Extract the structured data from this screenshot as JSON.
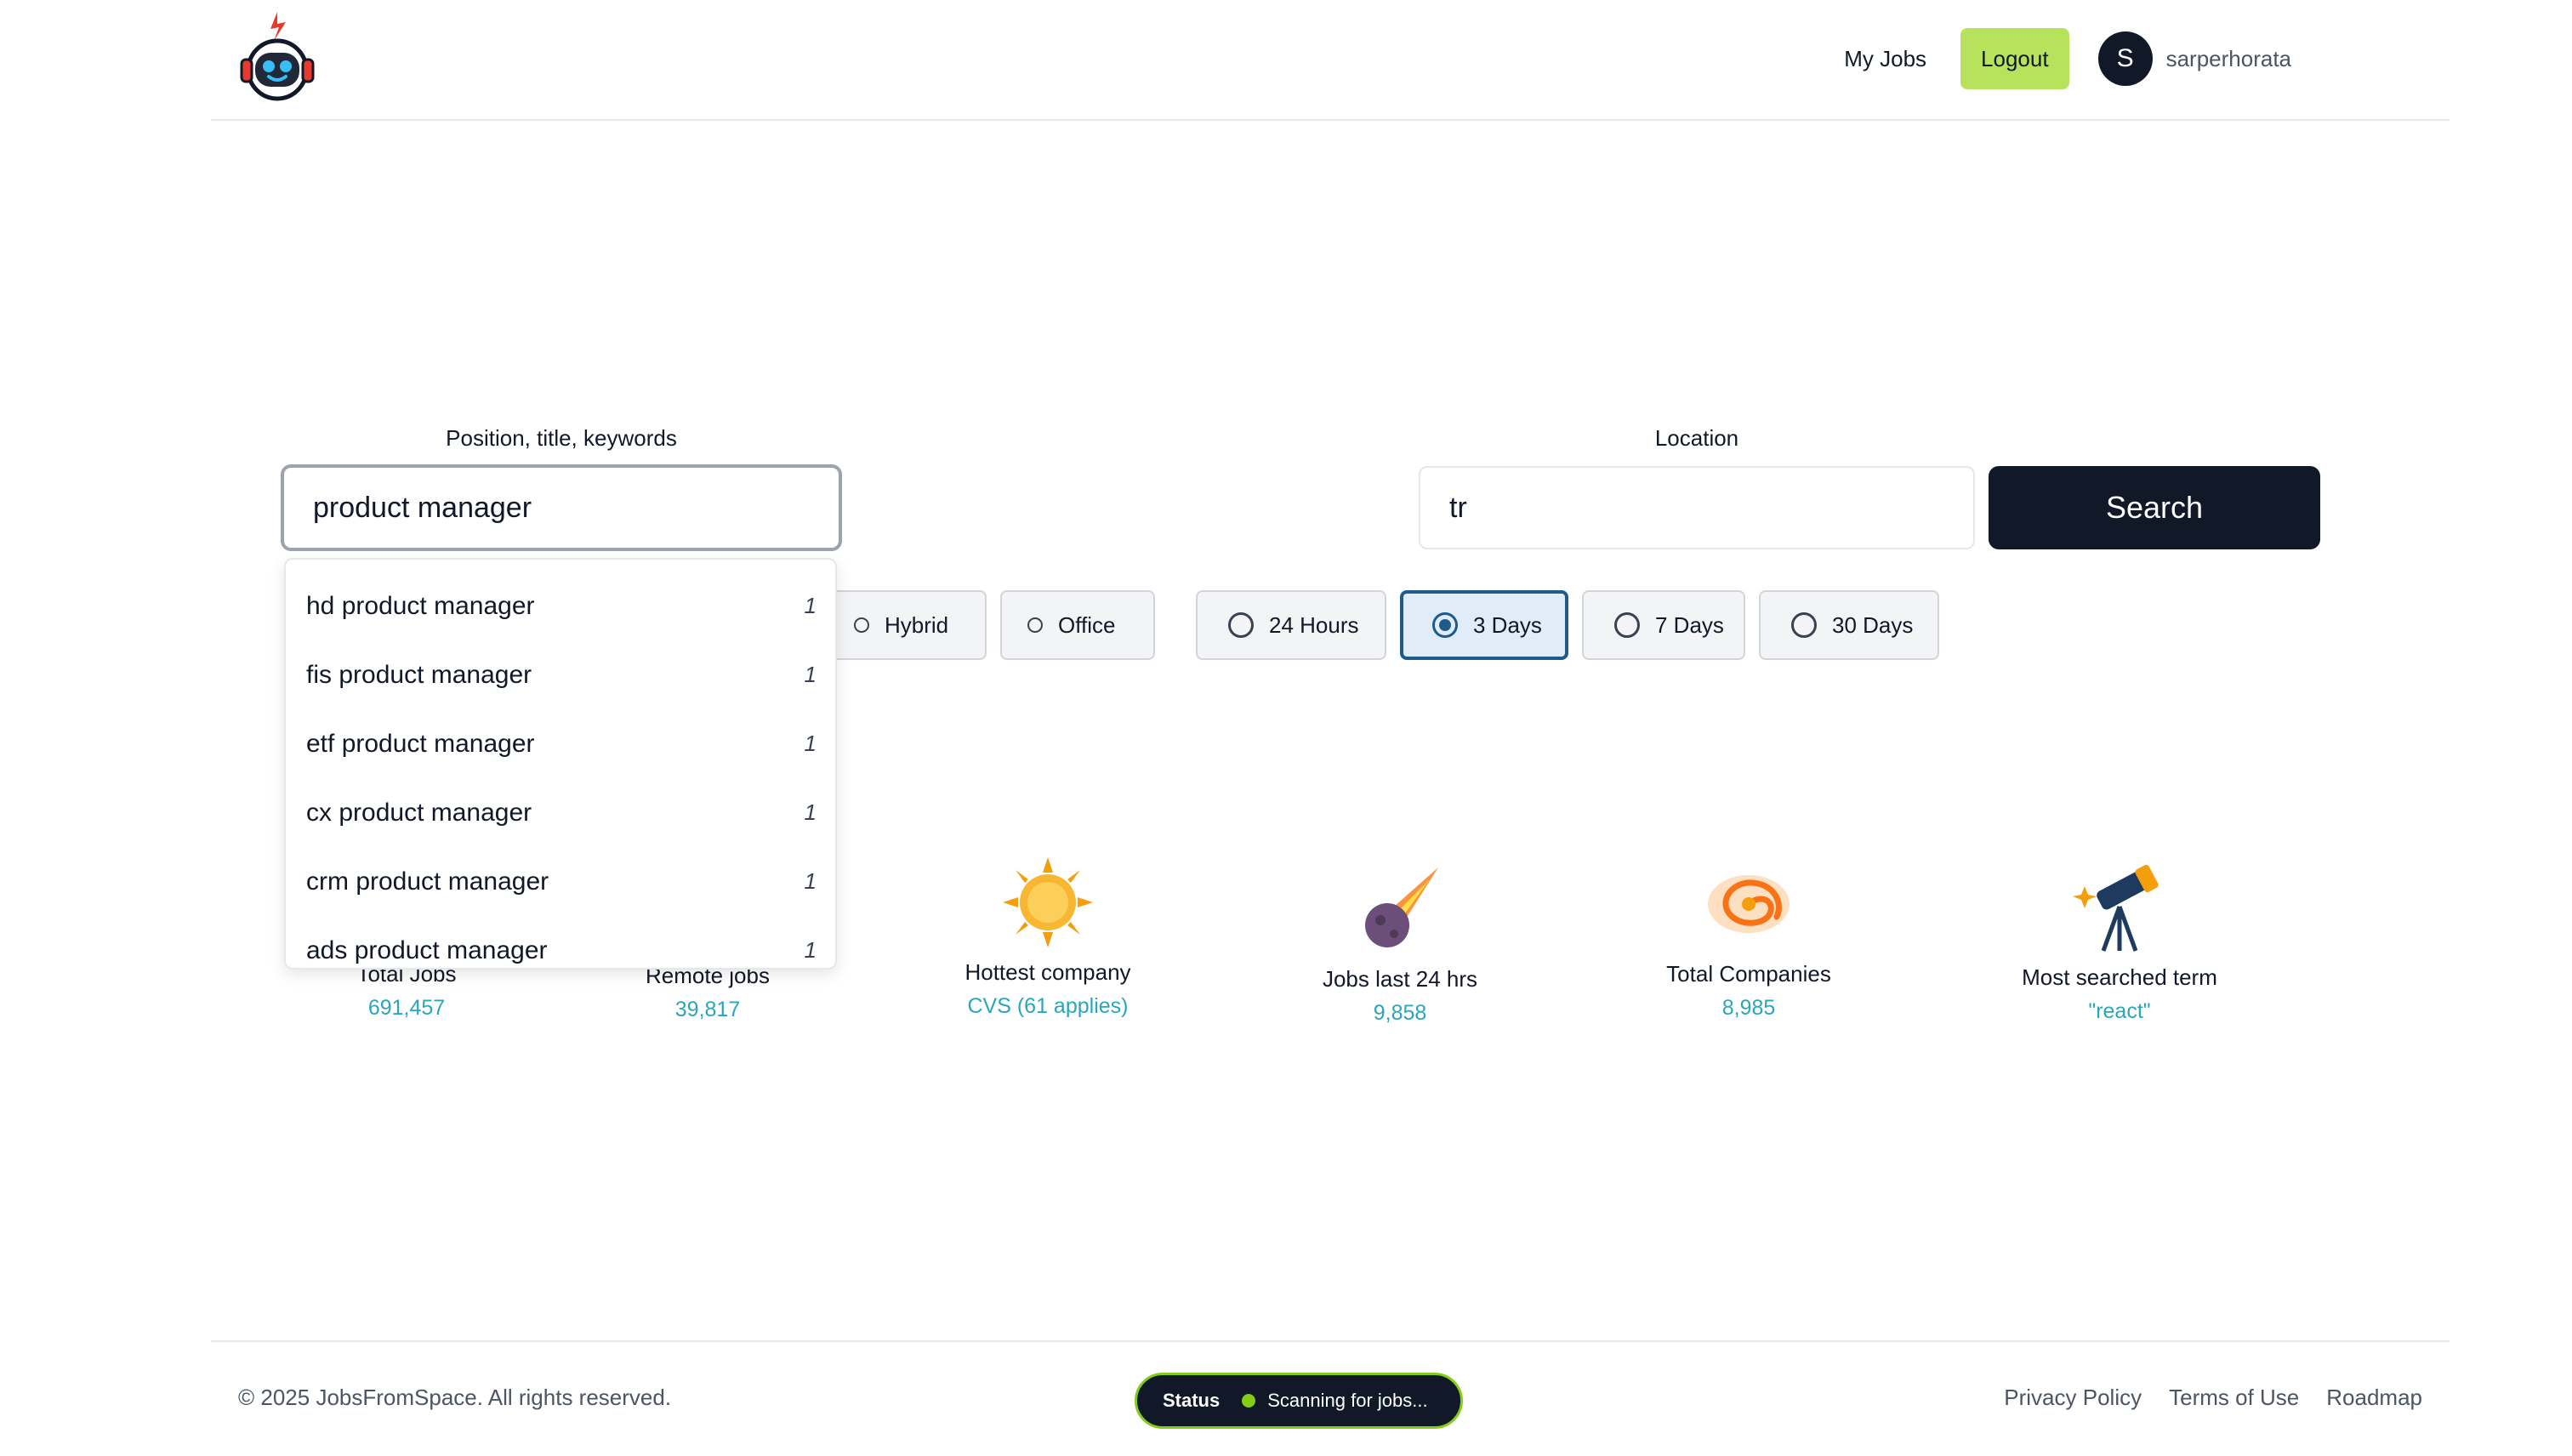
{
  "header": {
    "logo_icon": "robot-astronaut-logo",
    "nav": {
      "my_jobs": "My Jobs",
      "logout": "Logout"
    },
    "user": {
      "avatar_initial": "S",
      "username": "sarperhorata"
    }
  },
  "search": {
    "keywords_label": "Position, title, keywords",
    "keywords_value": "product manager",
    "location_label": "Location",
    "location_value": "tr",
    "search_button": "Search"
  },
  "filters": {
    "work_type": [
      {
        "label": "Hybrid",
        "selected": false
      },
      {
        "label": "Office",
        "selected": false
      }
    ],
    "date_posted": [
      {
        "label": "24 Hours",
        "selected": false
      },
      {
        "label": "3 Days",
        "selected": true
      },
      {
        "label": "7 Days",
        "selected": false
      },
      {
        "label": "30 Days",
        "selected": false
      }
    ]
  },
  "suggestions": [
    {
      "text": "hd product manager",
      "count": "1"
    },
    {
      "text": "fis product manager",
      "count": "1"
    },
    {
      "text": "etf product manager",
      "count": "1"
    },
    {
      "text": "cx product manager",
      "count": "1"
    },
    {
      "text": "crm product manager",
      "count": "1"
    },
    {
      "text": "ads product manager",
      "count": "1"
    }
  ],
  "stats": [
    {
      "title": "Total Jobs",
      "value": "691,457",
      "icon": "rocket-icon"
    },
    {
      "title": "Remote jobs",
      "value": "39,817",
      "icon": "planet-icon"
    },
    {
      "title": "Hottest company",
      "value": "CVS (61 applies)",
      "icon": "sun-icon"
    },
    {
      "title": "Jobs last 24 hrs",
      "value": "9,858",
      "icon": "meteor-icon"
    },
    {
      "title": "Total Companies",
      "value": "8,985",
      "icon": "galaxy-icon"
    },
    {
      "title": "Most searched term",
      "value": "\"react\"",
      "icon": "telescope-icon"
    }
  ],
  "footer": {
    "copyright": "© 2025 JobsFromSpace. All rights reserved.",
    "status_label": "Status",
    "status_text": "Scanning for jobs...",
    "links": [
      "Privacy Policy",
      "Terms of Use",
      "Roadmap"
    ]
  },
  "colors": {
    "primary_dark": "#111827",
    "accent_green": "#b6e25c",
    "stat_value": "#2ba6b8",
    "selected_chip_border": "#1e5a8a"
  }
}
